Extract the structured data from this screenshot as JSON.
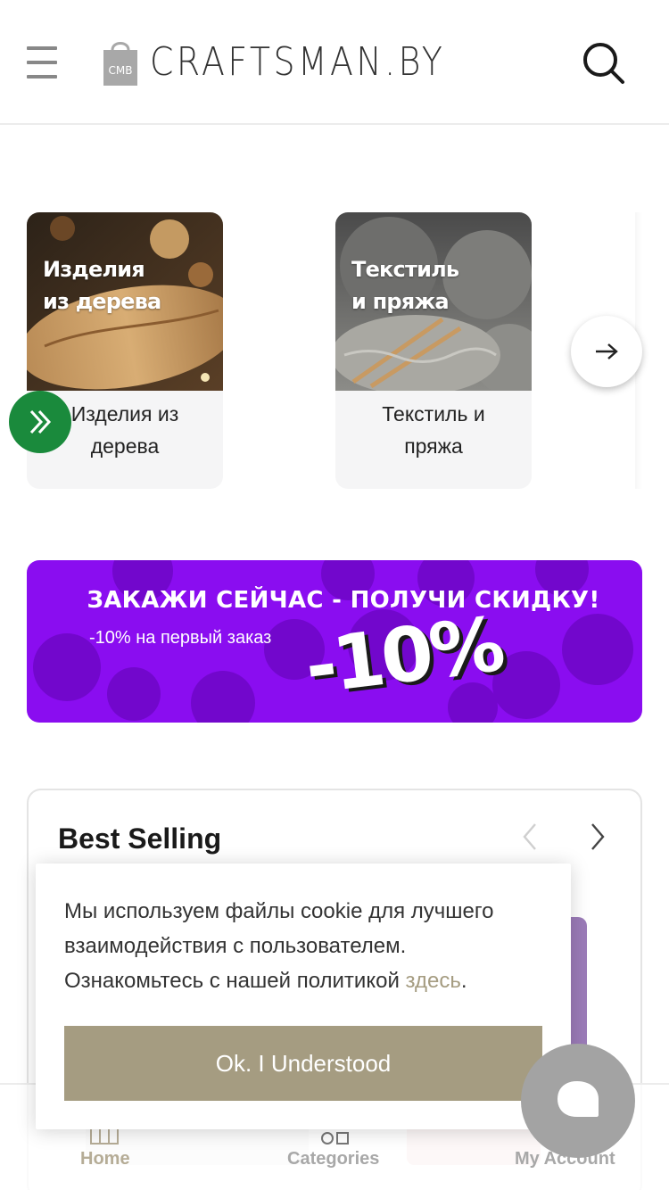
{
  "header": {
    "logo_bag_text": "CMB",
    "logo_text": "CRAFTSMAN.BY",
    "menu_icon": "hamburger-icon",
    "search_icon": "search-icon"
  },
  "categories": {
    "items": [
      {
        "image_text": "Изделия из дерева",
        "image_line1": "Изделия",
        "image_line2": "из дерева",
        "label_line1": "Изделия из",
        "label_line2": "дерева"
      },
      {
        "image_text": "Текстиль и пряжа",
        "image_line1": "Текстиль",
        "image_line2": "и пряжа",
        "label_line1": "Текстиль и",
        "label_line2": "пряжа"
      }
    ],
    "next_icon": "arrow-right-icon",
    "expand_icon": "double-chevron-right-icon"
  },
  "banner": {
    "headline": "ЗАКАЖИ СЕЙЧАС - ПОЛУЧИ СКИДКУ!",
    "subtitle": "-10% на первый заказ",
    "big_text": "-10%",
    "bg_color": "#8a0df0"
  },
  "best_selling": {
    "title": "Best Selling",
    "prev_icon": "chevron-left-icon",
    "next_icon": "chevron-right-icon"
  },
  "cookie": {
    "text_main": "Мы используем файлы cookie для лучшего взаимодействия с пользователем. Ознакомьтесь с нашей политикой ",
    "link_text": "здесь",
    "text_end": ".",
    "button_label": "Ok. I Understood",
    "accent_color": "#a59c81"
  },
  "bottom_nav": {
    "home": "Home",
    "categories": "Categories",
    "account": "My Account"
  },
  "chat": {
    "icon": "chat-bubble-icon"
  }
}
